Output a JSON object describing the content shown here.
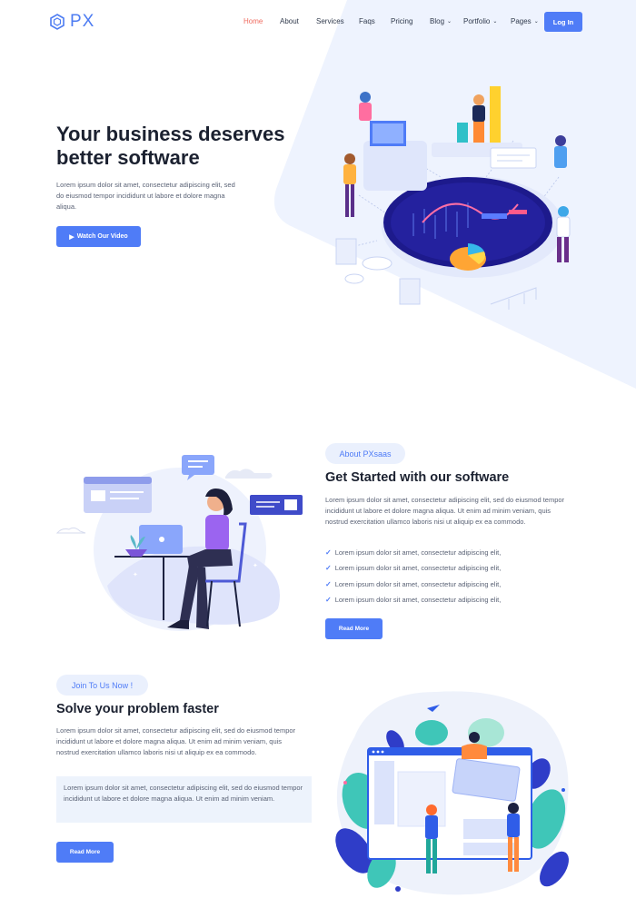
{
  "header": {
    "logo_text": "PX",
    "nav": [
      {
        "label": "Home",
        "active": true,
        "dropdown": false
      },
      {
        "label": "About",
        "active": false,
        "dropdown": false
      },
      {
        "label": "Services",
        "active": false,
        "dropdown": false
      },
      {
        "label": "Faqs",
        "active": false,
        "dropdown": false
      },
      {
        "label": "Pricing",
        "active": false,
        "dropdown": false
      },
      {
        "label": "Blog",
        "active": false,
        "dropdown": true
      },
      {
        "label": "Portfolio",
        "active": false,
        "dropdown": true
      },
      {
        "label": "Pages",
        "active": false,
        "dropdown": true
      }
    ],
    "login_label": "Log In"
  },
  "hero": {
    "title": "Your business deserves better software",
    "description": "Lorem ipsum dolor sit amet, consectetur adipiscing elit, sed do eiusmod tempor incididunt ut labore et dolore magna aliqua.",
    "button_label": "Watch Our Video",
    "button_icon": "play-icon"
  },
  "about": {
    "pill": "About PXsaas",
    "title": "Get Started with our software",
    "description": "Lorem ipsum dolor sit amet, consectetur adipiscing elit, sed do eiusmod tempor incididunt ut labore et dolore magna aliqua. Ut enim ad minim veniam, quis nostrud exercitation ullamco laboris nisi ut aliquip ex ea commodo.",
    "checklist": [
      "Lorem ipsum dolor sit amet, consectetur adipiscing elit,",
      "Lorem ipsum dolor sit amet, consectetur adipiscing elit,",
      "Lorem ipsum dolor sit amet, consectetur adipiscing elit,",
      "Lorem ipsum dolor sit amet, consectetur adipiscing elit,"
    ],
    "button_label": "Read More"
  },
  "solve": {
    "pill": "Join To Us Now !",
    "title": "Solve your problem faster",
    "description": "Lorem ipsum dolor sit amet, consectetur adipiscing elit, sed do eiusmod tempor incididunt ut labore et dolore magna aliqua. Ut enim ad minim veniam, quis nostrud exercitation ullamco laboris nisi ut aliquip ex ea commodo.",
    "quote": "Lorem ipsum dolor sit amet, consectetur adipiscing elit, sed do eiusmod tempor incididunt ut labore et dolore magna aliqua. Ut enim ad minim veniam.",
    "button_label": "Read More"
  },
  "colors": {
    "primary": "#4f7cf7",
    "active_nav": "#ef6b5f",
    "hero_bg": "#eef3fe",
    "pill_bg": "#eaf0fd",
    "heading": "#1b2130",
    "body_text": "#5a6275"
  }
}
